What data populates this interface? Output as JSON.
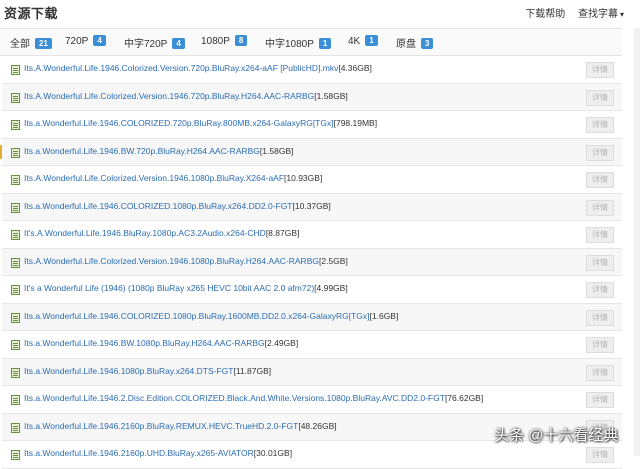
{
  "header": {
    "title": "资源下载",
    "links": [
      "下载帮助",
      "查找字幕"
    ],
    "dropdown_icon": "chevron-down-icon"
  },
  "filters": [
    {
      "label": "全部",
      "count": "21",
      "active": true
    },
    {
      "label": "720P",
      "count": "4"
    },
    {
      "label": "中字720P",
      "count": "4"
    },
    {
      "label": "1080P",
      "count": "8"
    },
    {
      "label": "中字1080P",
      "count": "1"
    },
    {
      "label": "4K",
      "count": "1"
    },
    {
      "label": "原盘",
      "count": "3"
    }
  ],
  "colors": {
    "badge": "#3a8fd6",
    "link": "#2a6cb3",
    "accent_mark": "#e0b030"
  },
  "row_icon": "file-icon",
  "detail_label": "详情",
  "rows": [
    {
      "name": "Its.A.Wonderful.Life.1946.Colorized.Version.720p.BluRay.x264-aAF [PublicHD].mkv",
      "size": "[4.36GB]"
    },
    {
      "name": "Its.A.Wonderful.Life.Colorized.Version.1946.720p.BluRay.H264.AAC-RARBG",
      "size": "[1.58GB]"
    },
    {
      "name": "Its.a.Wonderful.Life.1946.COLORIZED.720p.BluRay.800MB.x264-GalaxyRG[TGx]",
      "size": "[798.19MB]"
    },
    {
      "name": "Its.a.Wonderful.Life.1946.BW.720p.BluRay.H264.AAC-RARBG",
      "size": "[1.58GB]"
    },
    {
      "name": "Its.A.Wonderful.Life.Colorized.Version.1946.1080p.BluRay.X264-aAF",
      "size": "[10.93GB]"
    },
    {
      "name": "Its.a.Wonderful.Life.1946.COLORIZED.1080p.BluRay.x264.DD2.0-FGT",
      "size": "[10.37GB]"
    },
    {
      "name": "It's.A.Wonderful.Life.1946.BluRay.1080p.AC3.2Audio.x264-CHD",
      "size": "[8.87GB]"
    },
    {
      "name": "Its.A.Wonderful.Life.Colorized.Version.1946.1080p.BluRay.H264.AAC-RARBG",
      "size": "[2.5GB]"
    },
    {
      "name": "It's a Wonderful Life (1946) (1080p BluRay x265 HEVC 10bit AAC 2.0 afm72)",
      "size": "[4.99GB]"
    },
    {
      "name": "Its.a.Wonderful.Life.1946.COLORIZED.1080p.BluRay.1600MB.DD2.0.x264-GalaxyRG[TGx]",
      "size": "[1.6GB]"
    },
    {
      "name": "Its.a.Wonderful.Life.1946.BW.1080p.BluRay.H264.AAC-RARBG",
      "size": "[2.49GB]"
    },
    {
      "name": "Its.a.Wonderful.Life.1946.1080p.BluRay.x264.DTS-FGT",
      "size": "[11.87GB]"
    },
    {
      "name": "Its.a.Wonderful.Life.1946.2.Disc.Edition.COLORIZED.Black.And.White.Versions.1080p.BluRay.AVC.DD2.0-FGT",
      "size": "[76.62GB]"
    },
    {
      "name": "Its.a.Wonderful.Life.1946.2160p.BluRay.REMUX.HEVC.TrueHD.2.0-FGT",
      "size": "[48.26GB]"
    },
    {
      "name": "Its.a.Wonderful.Life.1946.2160p.UHD.BluRay.x265-AVIATOR",
      "size": "[30.01GB]"
    }
  ],
  "watermark": "头条 @十六看经典"
}
